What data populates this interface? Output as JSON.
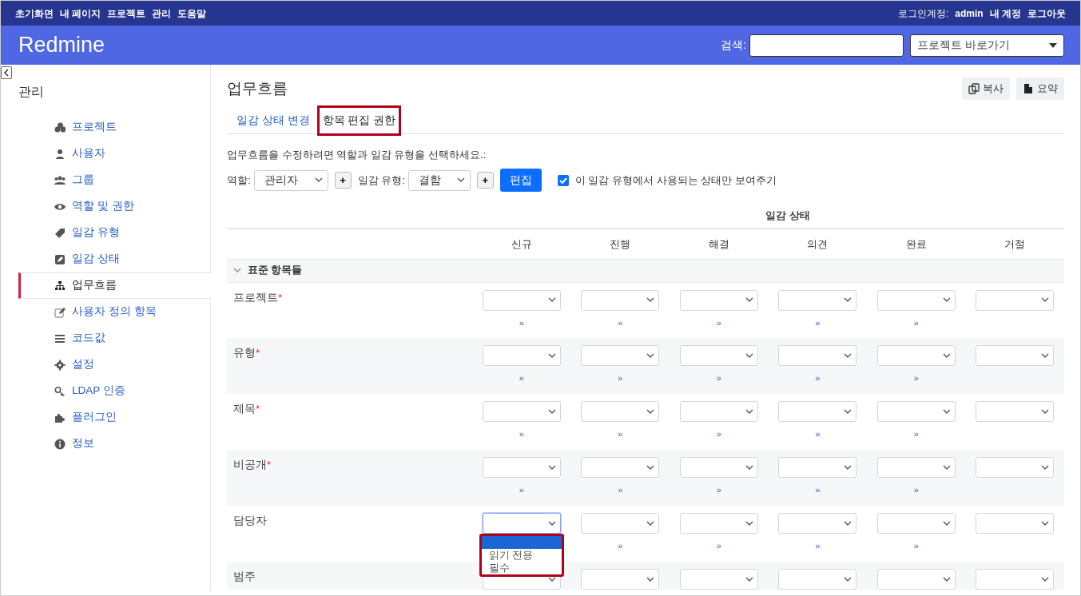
{
  "top_menu": [
    "초기화면",
    "내 페이지",
    "프로젝트",
    "관리",
    "도움말"
  ],
  "account": {
    "label": "로그인계정:",
    "user": "admin",
    "links": [
      "내 계정",
      "로그아웃"
    ]
  },
  "header": {
    "title": "Redmine",
    "search_label": "검색:",
    "project_jump": "프로젝트 바로가기"
  },
  "sidebar": {
    "title": "관리",
    "items": [
      {
        "label": "프로젝트",
        "selected": false
      },
      {
        "label": "사용자",
        "selected": false
      },
      {
        "label": "그룹",
        "selected": false
      },
      {
        "label": "역할 및 권한",
        "selected": false
      },
      {
        "label": "일감 유형",
        "selected": false
      },
      {
        "label": "일감 상태",
        "selected": false
      },
      {
        "label": "업무흐름",
        "selected": true
      },
      {
        "label": "사용자 정의 항목",
        "selected": false
      },
      {
        "label": "코드값",
        "selected": false
      },
      {
        "label": "설정",
        "selected": false
      },
      {
        "label": "LDAP 인증",
        "selected": false
      },
      {
        "label": "플러그인",
        "selected": false
      },
      {
        "label": "정보",
        "selected": false
      }
    ]
  },
  "main": {
    "title": "업무흐름",
    "actions": [
      "복사",
      "요약"
    ],
    "tabs": [
      {
        "label": "일감 상태 변경",
        "selected": false
      },
      {
        "label": "항목 편집 권한",
        "selected": true
      }
    ],
    "instructions": "업무흐름을 수정하려면 역할과 일감 유형을 선택하세요.:",
    "filter": {
      "role_label": "역할:",
      "role": "관리자",
      "role_add": "+",
      "tracker_label": "일감 유형:",
      "tracker": "결함",
      "tracker_add": "+",
      "button": "편집",
      "checkbox": {
        "label": "이 일감 유형에서 사용되는 상태만 보여주기",
        "checked": true
      }
    },
    "table": {
      "group_heading": "일감 상태",
      "columns": [
        "신규",
        "진행",
        "해결",
        "의견",
        "완료",
        "거절"
      ],
      "section": {
        "label": "표준 항목들",
        "expanded": true
      },
      "rows": [
        {
          "label": "프로젝트",
          "required_mark": "*",
          "cells": [
            {
              "focused": false,
              "copy_link": "»"
            },
            {
              "focused": false,
              "copy_link": "»"
            },
            {
              "focused": false,
              "copy_link": "»"
            },
            {
              "focused": false,
              "copy_link": "»"
            },
            {
              "focused": false,
              "copy_link": "»"
            },
            {
              "focused": false
            }
          ]
        },
        {
          "label": "유형",
          "required_mark": "*",
          "cells": [
            {
              "focused": false,
              "copy_link": "»"
            },
            {
              "focused": false,
              "copy_link": "»"
            },
            {
              "focused": false,
              "copy_link": "»"
            },
            {
              "focused": false,
              "copy_link": "»"
            },
            {
              "focused": false,
              "copy_link": "»"
            },
            {
              "focused": false
            }
          ]
        },
        {
          "label": "제목",
          "required_mark": "*",
          "cells": [
            {
              "focused": false,
              "copy_link": "»"
            },
            {
              "focused": false,
              "copy_link": "»"
            },
            {
              "focused": false,
              "copy_link": "»"
            },
            {
              "focused": false,
              "copy_link": "»"
            },
            {
              "focused": false,
              "copy_link": "»"
            },
            {
              "focused": false
            }
          ]
        },
        {
          "label": "비공개",
          "required_mark": "*",
          "cells": [
            {
              "focused": false,
              "copy_link": "»"
            },
            {
              "focused": false,
              "copy_link": "»"
            },
            {
              "focused": false,
              "copy_link": "»"
            },
            {
              "focused": false,
              "copy_link": "»"
            },
            {
              "focused": false,
              "copy_link": "»"
            },
            {
              "focused": false
            }
          ]
        },
        {
          "label": "담당자",
          "cells": [
            {
              "focused": true,
              "dropdown": [
                {
                  "highlighted": true
                },
                {
                  "label": "읽기 전용",
                  "highlighted": false
                },
                {
                  "label": "필수",
                  "highlighted": false
                }
              ]
            },
            {
              "focused": false,
              "copy_link": "»"
            },
            {
              "focused": false,
              "copy_link": "»"
            },
            {
              "focused": false,
              "copy_link": "»"
            },
            {
              "focused": false,
              "copy_link": "»"
            },
            {
              "focused": false
            }
          ]
        },
        {
          "label": "범주",
          "cells": [
            {
              "focused": false
            },
            {
              "focused": false
            },
            {
              "focused": false
            },
            {
              "focused": false
            },
            {
              "focused": false
            },
            {
              "focused": false
            }
          ]
        }
      ]
    }
  }
}
